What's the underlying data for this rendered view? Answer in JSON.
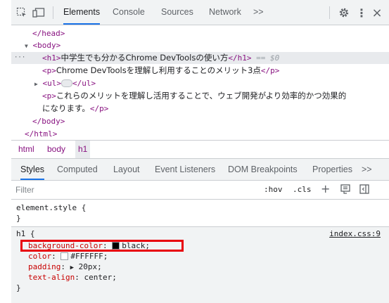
{
  "toolbar": {
    "tabs": [
      {
        "label": "Elements",
        "active": true
      },
      {
        "label": "Console"
      },
      {
        "label": "Sources"
      },
      {
        "label": "Network"
      }
    ],
    "more_tabs": ">>",
    "icons": [
      "inspect-element-icon",
      "device-toolbar-icon",
      "settings-gear-icon",
      "kebab-menu-icon",
      "close-icon"
    ],
    "close_glyph": "×",
    "kebab_glyph": "⋮",
    "accent_color": "#1a73e8"
  },
  "dom_tree": {
    "ellipsis": "···",
    "lines": [
      {
        "text": "</head>"
      },
      {
        "arrow": "▼",
        "text": "<body>"
      },
      {
        "h1_open": "<h1>",
        "h1_text": "中学生でも分かるChrome DevToolsの使い方",
        "h1_close": "</h1>",
        "eq": " == $0"
      },
      {
        "p1_open": "<p>",
        "p1_text": "Chrome DevToolsを理解し利用することのメリット3点",
        "p1_close": "</p>"
      },
      {
        "arrow": "▶",
        "ul_open": "<ul>",
        "ul_close": "</ul>"
      },
      {
        "p2_open": "<p>",
        "p2_text_1": "これらのメリットを理解し活用することで、ウェブ開発がより効率的かつ効果的",
        "p2_text_2": "になります。",
        "p2_close": "</p>"
      },
      {
        "text": "</body>"
      },
      {
        "text": "</html>"
      }
    ]
  },
  "breadcrumb": [
    "html",
    "body",
    "h1"
  ],
  "sidebar_tabs": [
    {
      "label": "Styles",
      "active": true
    },
    {
      "label": "Computed"
    },
    {
      "label": "Layout"
    },
    {
      "label": "Event Listeners"
    },
    {
      "label": "DOM Breakpoints"
    },
    {
      "label": "Properties"
    }
  ],
  "sidebar_more": ">>",
  "filter": {
    "placeholder": "Filter",
    "hov": ":hov",
    "cls": ".cls",
    "plus": "+"
  },
  "styles": {
    "element_style": {
      "selector": "element.style {",
      "close": "}"
    },
    "h1_rule": {
      "selector": "h1 {",
      "source": "index.css:9",
      "properties": [
        {
          "name": "background-color",
          "value": "black",
          "swatch": "#000000"
        },
        {
          "name": "color",
          "value": "#FFFFFF",
          "swatch": "#FFFFFF"
        },
        {
          "name": "padding",
          "value": "20px",
          "expand": "▶"
        },
        {
          "name": "text-align",
          "value": "center"
        }
      ],
      "close": "}"
    },
    "highlight_color": "#e8000b"
  }
}
